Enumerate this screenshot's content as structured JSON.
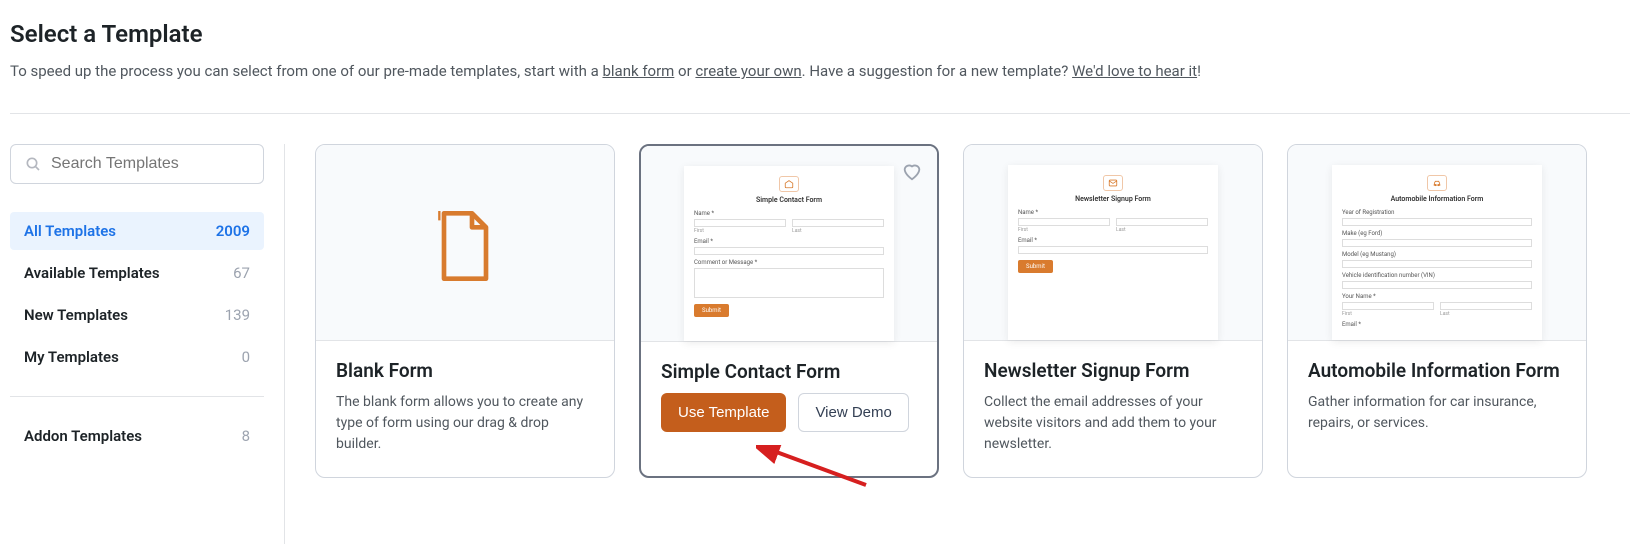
{
  "header": {
    "title": "Select a Template",
    "intro_before": "To speed up the process you can select from one of our pre-made templates, start with a ",
    "link_blank": "blank form",
    "intro_or": " or ",
    "link_create": "create your own",
    "intro_after": ". Have a suggestion for a new template? ",
    "link_hear": "We'd love to hear it",
    "intro_end": "!"
  },
  "search": {
    "placeholder": "Search Templates"
  },
  "sidebar": {
    "items": [
      {
        "label": "All Templates",
        "count": "2009",
        "active": true
      },
      {
        "label": "Available Templates",
        "count": "67"
      },
      {
        "label": "New Templates",
        "count": "139"
      },
      {
        "label": "My Templates",
        "count": "0"
      }
    ],
    "addon": {
      "label": "Addon Templates",
      "count": "8"
    }
  },
  "mini": {
    "simple_title": "Simple Contact Form",
    "newsletter_title": "Newsletter Signup Form",
    "auto_title": "Automobile Information Form",
    "name": "Name *",
    "first": "First",
    "last": "Last",
    "email": "Email *",
    "comment": "Comment or Message *",
    "submit": "Submit",
    "year": "Year of Registration",
    "make": "Make (eg Ford)",
    "model": "Model (eg Mustang)",
    "vin": "Vehicle identification number (VIN)",
    "your_name": "Your Name *"
  },
  "cards": {
    "blank": {
      "title": "Blank Form",
      "desc": "The blank form allows you to create any type of form using our drag & drop builder."
    },
    "simple": {
      "title": "Simple Contact Form",
      "use": "Use Template",
      "demo": "View Demo"
    },
    "newsletter": {
      "title": "Newsletter Signup Form",
      "desc": "Collect the email addresses of your website visitors and add them to your newsletter."
    },
    "auto": {
      "title": "Automobile Information Form",
      "desc": "Gather information for car insurance, repairs, or services."
    }
  }
}
